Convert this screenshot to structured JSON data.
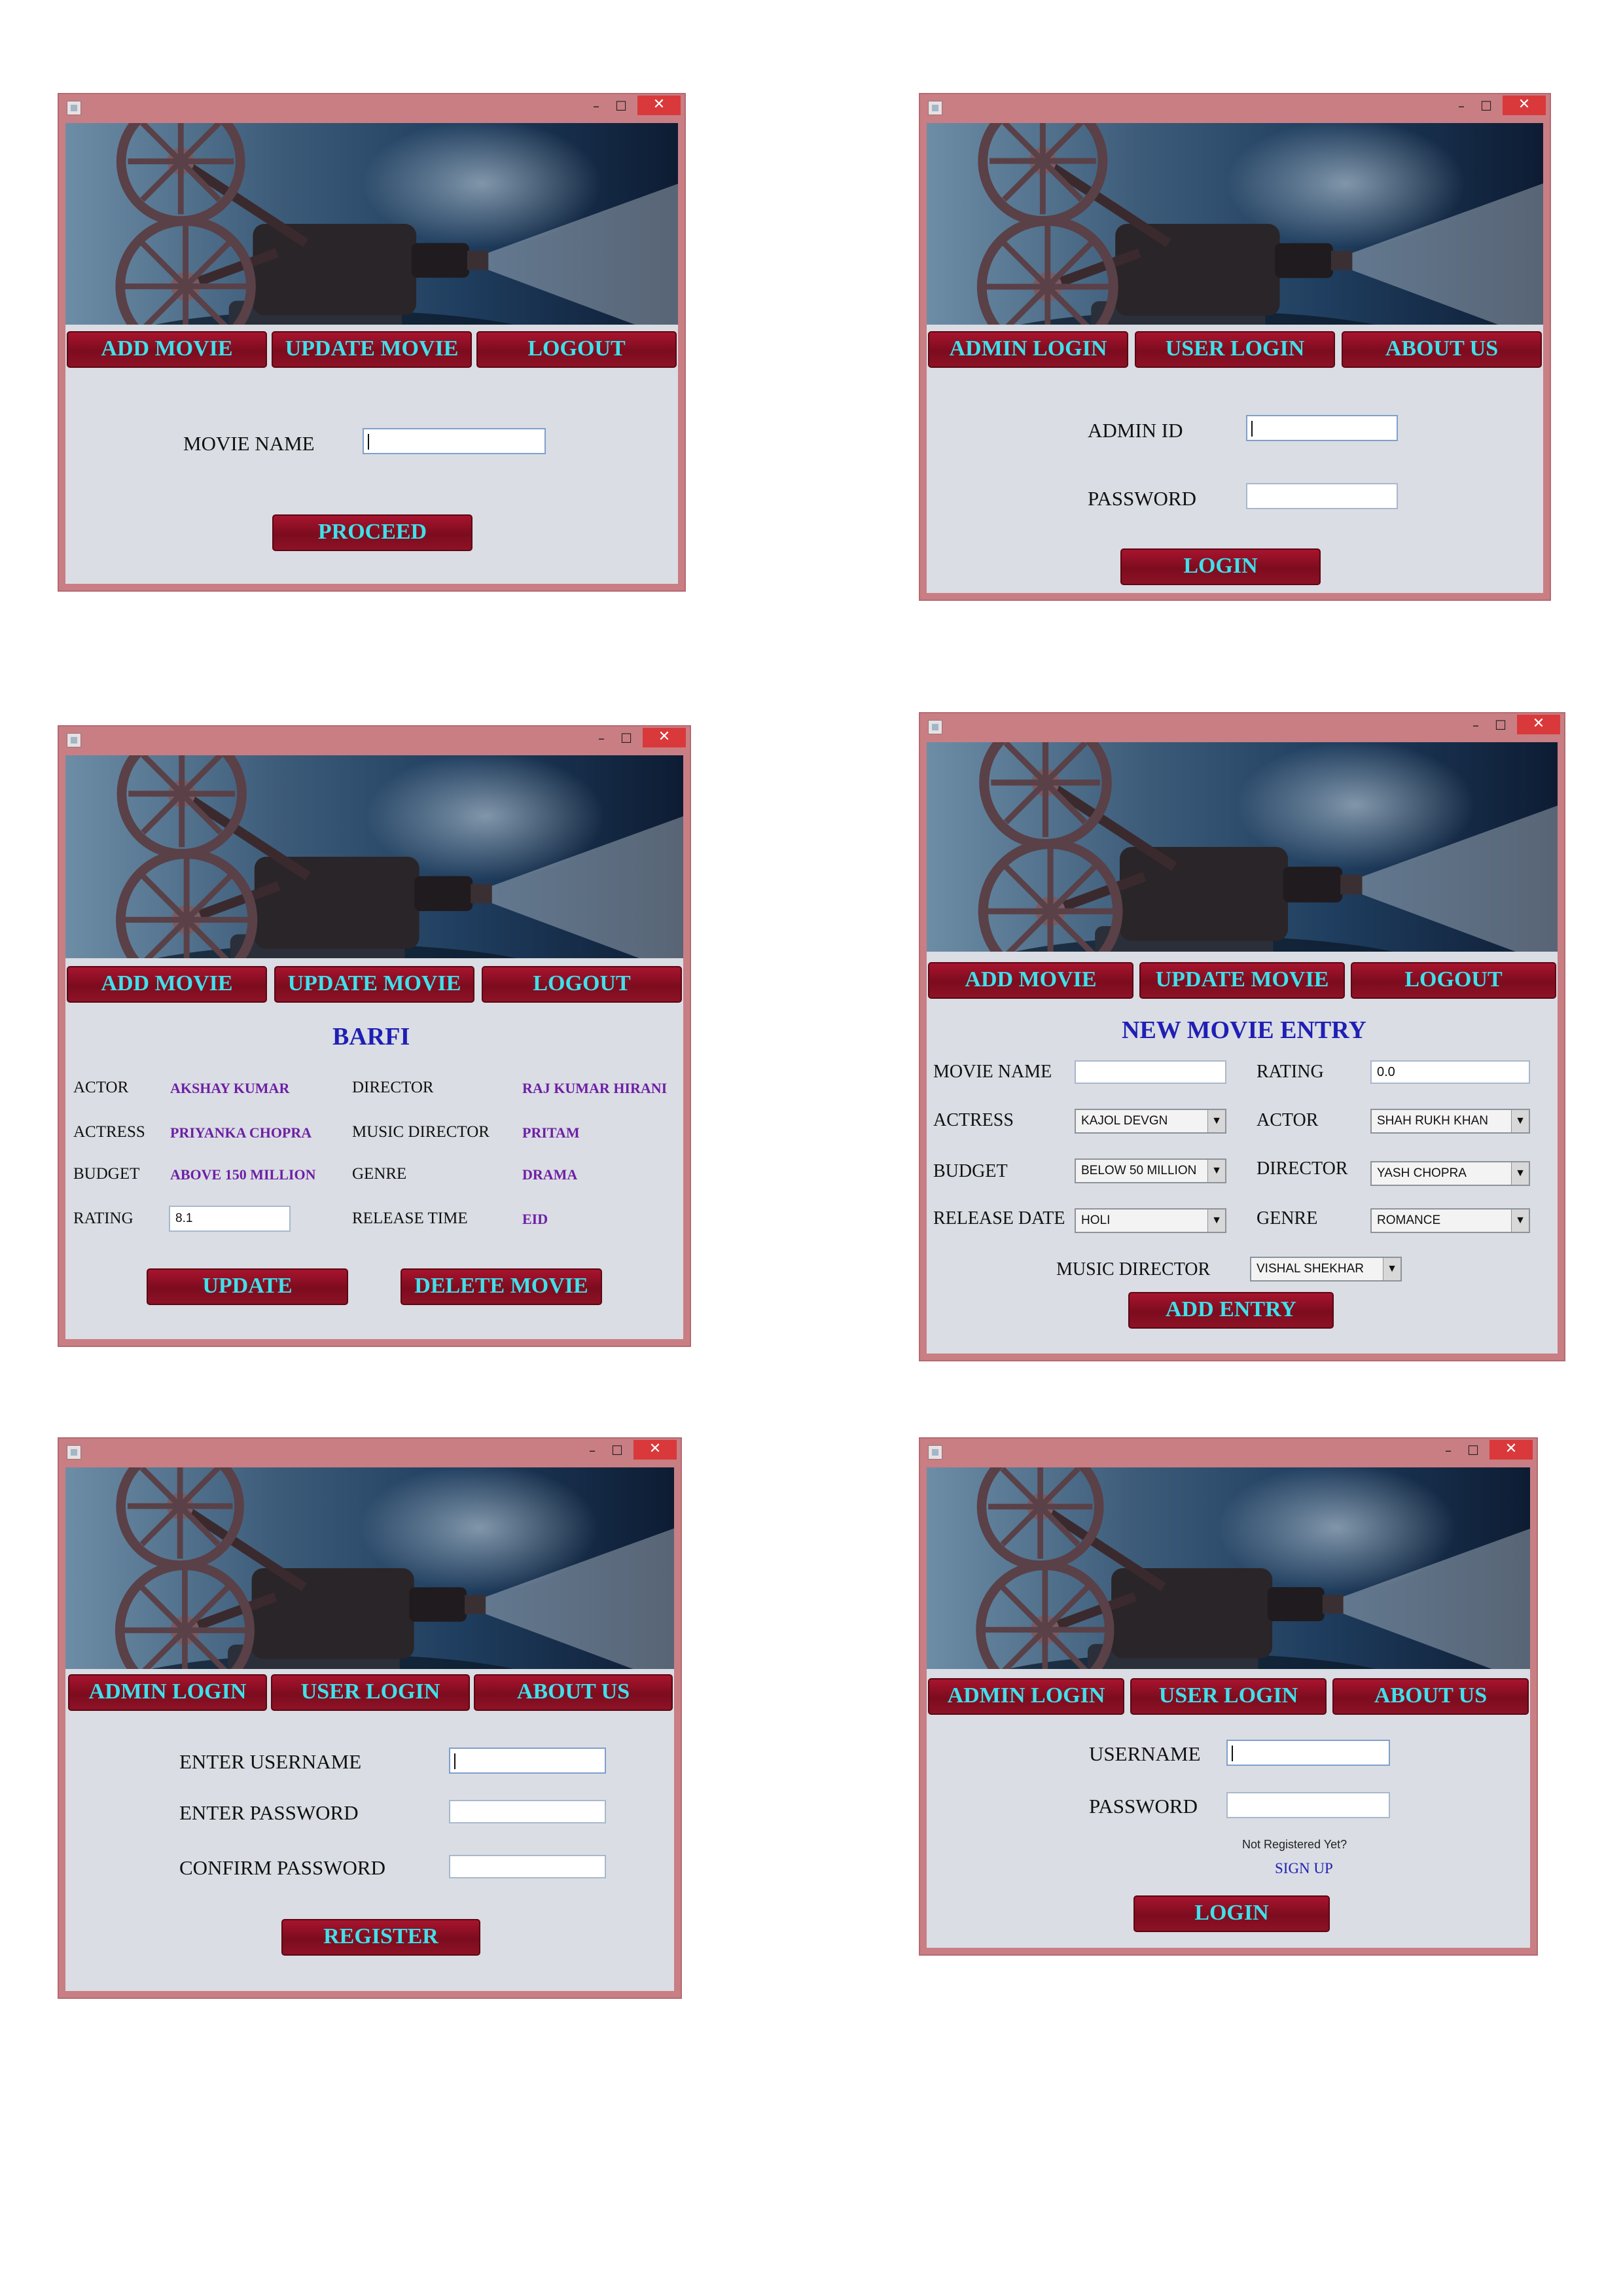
{
  "window": {
    "minimize": "–",
    "maximize": "☐",
    "close": "✕"
  },
  "update_search": {
    "nav": [
      "ADD MOVIE",
      "UPDATE MOVIE",
      "LOGOUT"
    ],
    "movie_name_label": "MOVIE NAME",
    "movie_name_value": "",
    "proceed_button": "PROCEED"
  },
  "admin_login": {
    "nav": [
      "ADMIN LOGIN",
      "USER LOGIN",
      "ABOUT US"
    ],
    "admin_id_label": "ADMIN ID",
    "password_label": "PASSWORD",
    "login_button": "LOGIN"
  },
  "update_movie": {
    "nav": [
      "ADD MOVIE",
      "UPDATE MOVIE",
      "LOGOUT"
    ],
    "title": "BARFI",
    "fields": {
      "actor_label": "ACTOR",
      "actor_value": "AKSHAY KUMAR",
      "director_label": "DIRECTOR",
      "director_value": "RAJ KUMAR HIRANI",
      "actress_label": "ACTRESS",
      "actress_value": "PRIYANKA CHOPRA",
      "music_label": "MUSIC DIRECTOR",
      "music_value": "PRITAM",
      "budget_label": "BUDGET",
      "budget_value": "ABOVE 150 MILLION",
      "genre_label": "GENRE",
      "genre_value": "DRAMA",
      "rating_label": "RATING",
      "rating_value": "8.1",
      "release_label": "RELEASE TIME",
      "release_value": "EID"
    },
    "update_button": "UPDATE",
    "delete_button": "DELETE MOVIE"
  },
  "new_movie": {
    "nav": [
      "ADD MOVIE",
      "UPDATE MOVIE",
      "LOGOUT"
    ],
    "title": "NEW MOVIE ENTRY",
    "movie_name_label": "MOVIE NAME",
    "rating_label": "RATING",
    "rating_value": "0.0",
    "actress_label": "ACTRESS",
    "actress_value": "KAJOL DEVGN",
    "actor_label": "ACTOR",
    "actor_value": "SHAH RUKH KHAN",
    "budget_label": "BUDGET",
    "budget_value": "BELOW 50 MILLION",
    "director_label": "DIRECTOR",
    "director_value": "YASH CHOPRA",
    "release_label": "RELEASE DATE",
    "release_value": "HOLI",
    "genre_label": "GENRE",
    "genre_value": "ROMANCE",
    "music_label": "MUSIC DIRECTOR",
    "music_value": "VISHAL SHEKHAR",
    "add_button": "ADD ENTRY"
  },
  "register": {
    "nav": [
      "ADMIN LOGIN",
      "USER LOGIN",
      "ABOUT US"
    ],
    "username_label": "ENTER USERNAME",
    "password_label": "ENTER PASSWORD",
    "confirm_label": "CONFIRM PASSWORD",
    "register_button": "REGISTER"
  },
  "user_login": {
    "nav": [
      "ADMIN LOGIN",
      "USER LOGIN",
      "ABOUT US"
    ],
    "username_label": "USERNAME",
    "password_label": "PASSWORD",
    "not_registered": "Not Registered Yet?",
    "signup_link": "SIGN UP",
    "login_button": "LOGIN"
  }
}
